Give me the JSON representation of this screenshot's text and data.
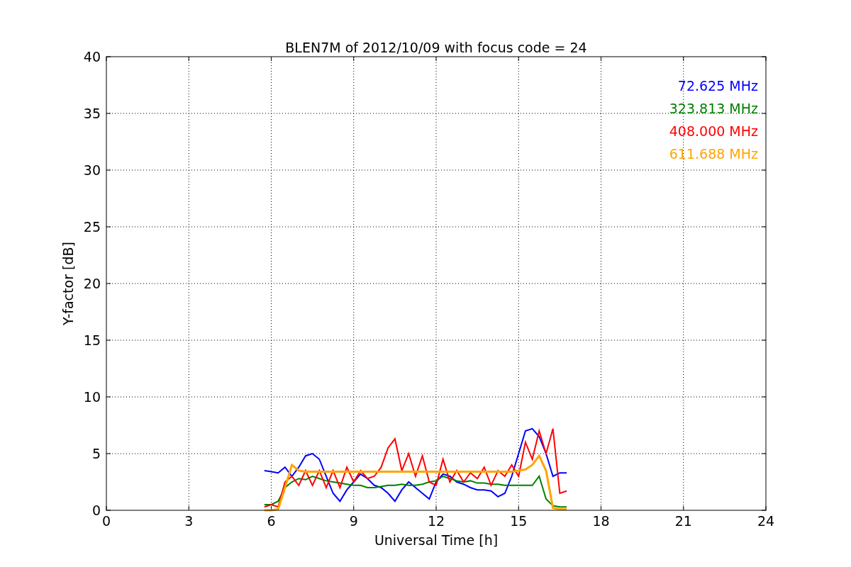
{
  "chart_data": {
    "type": "line",
    "title": "BLEN7M of 2012/10/09 with focus code = 24",
    "xlabel": "Universal Time [h]",
    "ylabel": "Y-factor [dB]",
    "x": [
      5.75,
      6.0,
      6.25,
      6.5,
      6.75,
      7.0,
      7.25,
      7.5,
      7.75,
      8.0,
      8.25,
      8.5,
      8.75,
      9.0,
      9.25,
      9.5,
      9.75,
      10.0,
      10.25,
      10.5,
      10.75,
      11.0,
      11.25,
      11.5,
      11.75,
      12.0,
      12.25,
      12.5,
      12.75,
      13.0,
      13.25,
      13.5,
      13.75,
      14.0,
      14.25,
      14.5,
      14.75,
      15.0,
      15.25,
      15.5,
      15.75,
      16.0,
      16.25,
      16.5,
      16.75
    ],
    "series": [
      {
        "name": "72.625 MHz",
        "color": "#0000ff",
        "values": [
          3.5,
          3.4,
          3.3,
          3.8,
          3.0,
          3.8,
          4.8,
          5.0,
          4.5,
          3.0,
          1.5,
          0.8,
          1.8,
          2.5,
          3.2,
          2.8,
          2.2,
          2.0,
          1.5,
          0.8,
          1.8,
          2.5,
          2.0,
          1.5,
          1.0,
          2.5,
          3.2,
          3.0,
          2.5,
          2.3,
          2.0,
          1.8,
          1.8,
          1.7,
          1.2,
          1.5,
          3.0,
          5.0,
          7.0,
          7.2,
          6.5,
          5.0,
          3.0,
          3.3,
          3.3
        ]
      },
      {
        "name": "323.813 MHz",
        "color": "#008000",
        "values": [
          0.5,
          0.5,
          0.8,
          2.0,
          2.5,
          2.8,
          2.7,
          3.0,
          2.8,
          2.6,
          2.5,
          2.4,
          2.3,
          2.2,
          2.2,
          2.0,
          2.0,
          2.1,
          2.2,
          2.2,
          2.3,
          2.2,
          2.2,
          2.3,
          2.5,
          2.6,
          3.0,
          2.8,
          2.6,
          2.5,
          2.6,
          2.4,
          2.4,
          2.3,
          2.3,
          2.2,
          2.2,
          2.2,
          2.2,
          2.2,
          3.0,
          1.0,
          0.4,
          0.3,
          0.3
        ]
      },
      {
        "name": "408.000 MHz",
        "color": "#ff0000",
        "values": [
          0.3,
          0.5,
          0.3,
          2.5,
          3.0,
          2.2,
          3.5,
          2.2,
          3.5,
          2.0,
          3.5,
          2.0,
          3.8,
          2.5,
          3.5,
          2.8,
          3.0,
          3.8,
          5.5,
          6.3,
          3.5,
          5.0,
          3.0,
          4.8,
          2.5,
          2.2,
          4.5,
          2.5,
          3.5,
          2.5,
          3.3,
          2.8,
          3.8,
          2.2,
          3.5,
          3.0,
          4.0,
          3.0,
          6.0,
          4.5,
          7.0,
          5.0,
          7.2,
          1.5,
          1.7
        ]
      },
      {
        "name": "611.688 MHz",
        "color": "#ffa500",
        "values": [
          0.0,
          0.0,
          0.1,
          2.0,
          4.0,
          3.5,
          3.4,
          3.4,
          3.4,
          3.4,
          3.4,
          3.4,
          3.4,
          3.4,
          3.4,
          3.4,
          3.4,
          3.4,
          3.4,
          3.4,
          3.4,
          3.4,
          3.4,
          3.4,
          3.4,
          3.4,
          3.4,
          3.4,
          3.4,
          3.4,
          3.4,
          3.4,
          3.4,
          3.4,
          3.4,
          3.4,
          3.4,
          3.5,
          3.6,
          4.0,
          4.8,
          3.5,
          0.2,
          0.1,
          0.1
        ]
      }
    ],
    "grid": true,
    "xlim": [
      0,
      24
    ],
    "ylim": [
      0,
      40
    ],
    "xticks": [
      0,
      3,
      6,
      9,
      12,
      15,
      18,
      21,
      24
    ],
    "yticks": [
      0,
      5,
      10,
      15,
      20,
      25,
      30,
      35,
      40
    ]
  }
}
